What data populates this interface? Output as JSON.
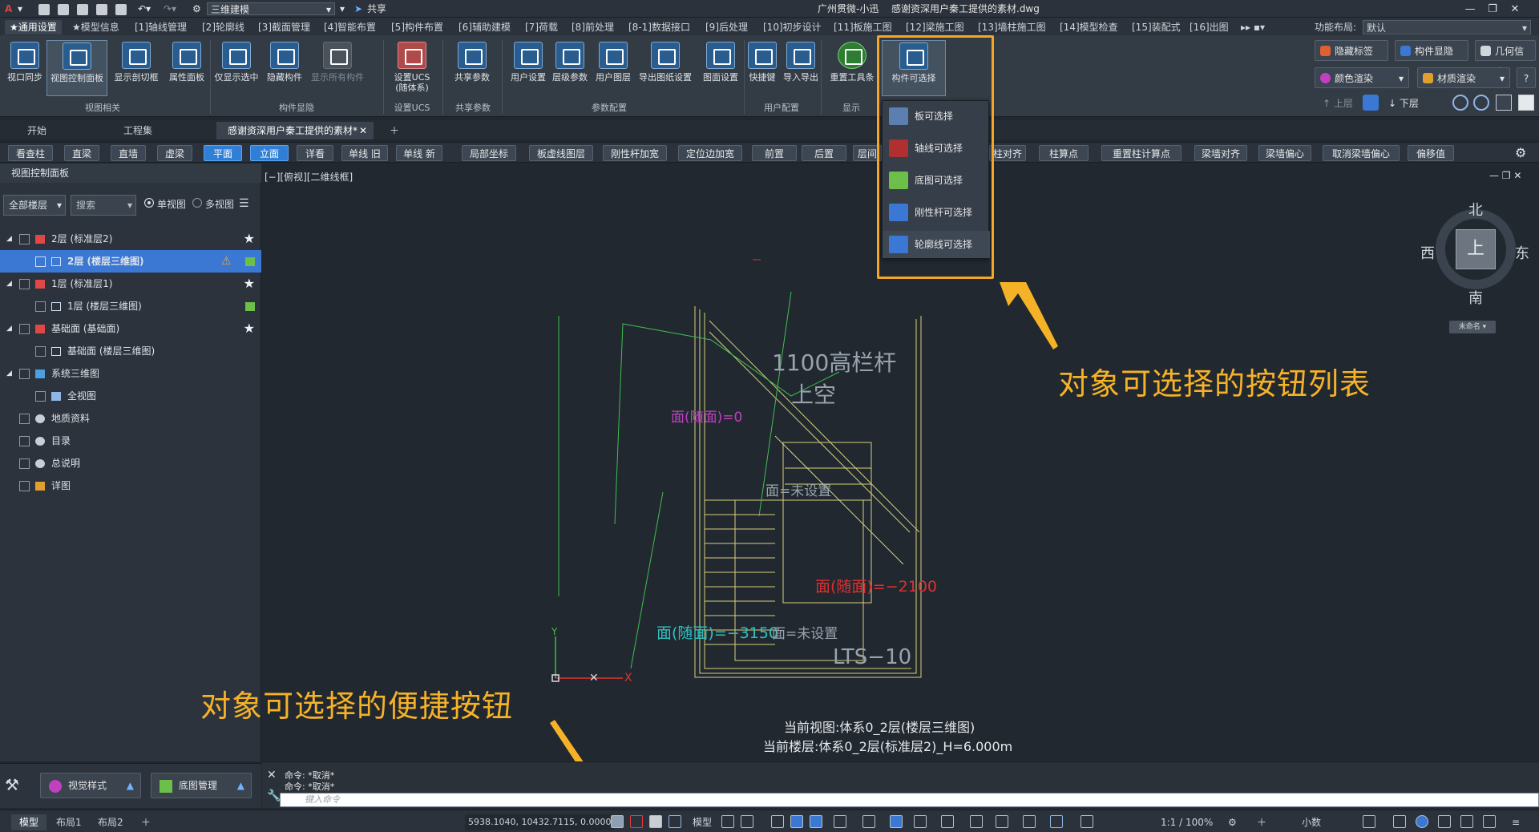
{
  "title": {
    "app_title": "广州贯微-小迅",
    "file_name": "感谢资深用户秦工提供的素材.dwg",
    "workspace": "三维建模",
    "share": "共享"
  },
  "ribbon_tabs": [
    "★通用设置",
    "★模型信息",
    "[1]轴线管理",
    "[2]轮廓线",
    "[3]截面管理",
    "[4]智能布置",
    "[5]构件布置",
    "[6]辅助建模",
    "[7]荷载",
    "[8]前处理",
    "[8-1]数据接口",
    "[9]后处理",
    "[10]初步设计",
    "[11]板施工图",
    "[12]梁施工图",
    "[13]墙柱施工图",
    "[14]模型检查",
    "[15]装配式",
    "[16]出图"
  ],
  "layout": {
    "label": "功能布局:",
    "value": "默认"
  },
  "ribbon_buttons": {
    "view_sync": "视口同步",
    "view_panel": "视图控制面板",
    "show_clip": "显示剖切框",
    "attr_panel": "属性面板",
    "show_selected": "仅显示选中",
    "hide_member": "隐藏构件",
    "show_all": "显示所有构件",
    "set_ucs": "设置UCS",
    "set_ucs_sub": "(随体系)",
    "share_params": "共享参数",
    "user_settings": "用户设置",
    "level_params": "层级参数",
    "user_layers": "用户图层",
    "export_drawing": "导出图纸设置",
    "plan_settings": "图面设置",
    "shortcut": "快捷键",
    "import_export": "导入导出",
    "reset_toolbar": "重置工具条",
    "selectable": "构件可选择"
  },
  "ribbon_groups": {
    "view": "视图相关",
    "visibility": "构件显隐",
    "ucs": "设置UCS",
    "share": "共享参数",
    "params": "参数配置",
    "user": "用户配置",
    "display": "显示"
  },
  "right_ribbon": {
    "hide_label": "隐藏标签",
    "member_vis": "构件显隐",
    "geo_info": "几何信息",
    "color_render": "颜色渲染",
    "material_render": "材质渲染",
    "up_floor": "上层",
    "down_floor": "下层"
  },
  "doc_tabs": [
    "开始",
    "工程集",
    "感谢资深用户秦工提供的素材*"
  ],
  "cmd_toolbar": [
    "看查柱",
    "直梁",
    "直墙",
    "虚梁",
    "平面",
    "立面",
    "详看",
    "单线 旧",
    "单线 新",
    "局部坐标",
    "板虚线图层",
    "刚性杆加宽",
    "定位边加宽",
    "前置",
    "后置",
    "层间",
    "柱对齐",
    "柱算点",
    "重置柱计算点",
    "梁墙对齐",
    "梁墙偏心",
    "取消梁墙偏心",
    "偏移值"
  ],
  "left_panel": {
    "title": "视图控制面板",
    "floor_select": "全部楼层",
    "search_placeholder": "搜索",
    "single_view": "单视图",
    "multi_view": "多视图",
    "tree": [
      "2层 (标准层2)",
      "2层 (楼层三维图)",
      "1层 (标准层1)",
      "1层 (楼层三维图)",
      "基础面 (基础面)",
      "基础面 (楼层三维图)",
      "系统三维图",
      "全视图",
      "地质资料",
      "目录",
      "总说明",
      "详图"
    ],
    "visual_style": "视觉样式",
    "base_manage": "底图管理"
  },
  "canvas": {
    "view_label": "[−][俯视][二维线框]",
    "drawing_texts": {
      "railing": "1100高栏杆",
      "void": "上空",
      "face_top": "面(随面)=0",
      "face_unset": "面=未设置",
      "face_2100": "面(随面)=−2100",
      "face_3150": "面(随面)=−3150",
      "face_unset2": "面=未设置",
      "lts": "LTS−10"
    },
    "current_view": "当前视图:体系0_2层(楼层三维图)",
    "current_floor": "当前楼层:体系0_2层(标准层2)_H=6.000m"
  },
  "view_cube": {
    "north": "北",
    "south": "南",
    "east": "东",
    "west": "西",
    "top": "上",
    "unnamed": "未命名"
  },
  "dropdown_menu": [
    "板可选择",
    "轴线可选择",
    "底图可选择",
    "刚性杆可选择",
    "轮廓线可选择"
  ],
  "annotations": {
    "list_label": "对象可选择的按钮列表",
    "shortcut_label": "对象可选择的便捷按钮"
  },
  "command": {
    "line1": "命令: *取消*",
    "line2": "命令: *取消*",
    "placeholder": "键入命令"
  },
  "status": {
    "tabs": [
      "模型",
      "布局1",
      "布局2"
    ],
    "coords": "5938.1040, 10432.7115, 0.0000",
    "model": "模型",
    "scale": "1:1 / 100%",
    "decimal": "小数"
  },
  "colors": {
    "accent_blue": "#2f7fd6",
    "highlight_orange": "#f6a623",
    "canvas_bg": "#212830",
    "drawing_yellow": "#d6d07a",
    "drawing_green": "#3fbf4f",
    "drawing_magenta": "#c040c0",
    "drawing_cyan": "#30c0c0",
    "drawing_red": "#e03030"
  }
}
